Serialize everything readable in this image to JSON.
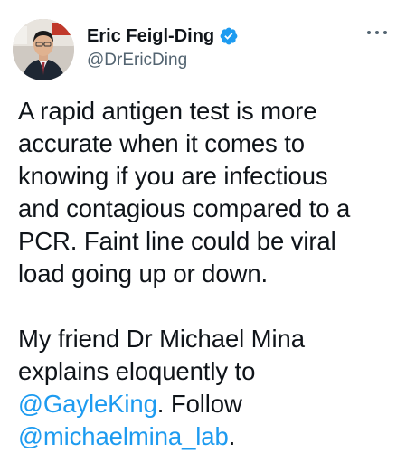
{
  "author": {
    "display_name": "Eric Feigl-Ding",
    "handle": "@DrEricDing",
    "verified": true,
    "avatar_icon": "profile-photo",
    "verified_icon": "verified-badge-icon",
    "more_icon": "more-options-icon"
  },
  "tweet": {
    "paragraph1": {
      "lines": [
        "A rapid antigen test is more",
        "accurate when it comes to",
        "knowing if you are infectious",
        "and contagious compared to a",
        "PCR. Faint line could be viral",
        "load going up or down."
      ]
    },
    "paragraph2": {
      "line1": "My friend Dr Michael Mina",
      "line2": "explains eloquently to",
      "mention1": "@GayleKing",
      "after_mention1": ". Follow",
      "mention2": "@michaelmina_lab",
      "after_mention2": "."
    }
  },
  "colors": {
    "link": "#1d9bf0",
    "text": "#0f1419",
    "secondary": "#536471"
  }
}
